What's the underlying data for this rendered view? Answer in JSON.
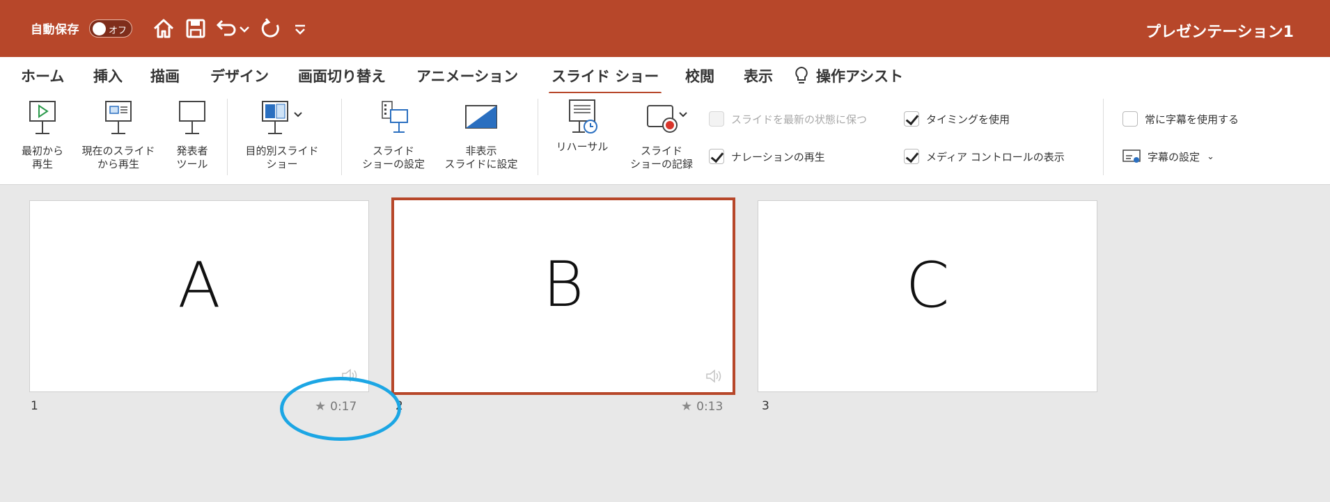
{
  "titlebar": {
    "autosave_label": "自動保存",
    "toggle_text": "オフ",
    "document_title": "プレゼンテーション1",
    "background": "#b7472a"
  },
  "tabs": [
    {
      "label": "ホーム"
    },
    {
      "label": "挿入"
    },
    {
      "label": "描画"
    },
    {
      "label": "デザイン"
    },
    {
      "label": "画面切り替え"
    },
    {
      "label": "アニメーション"
    },
    {
      "label": "スライド ショー",
      "active": true
    },
    {
      "label": "校閲"
    },
    {
      "label": "表示"
    },
    {
      "label": "操作アシスト"
    }
  ],
  "ribbon": {
    "from_start": "最初から\n再生",
    "from_current": "現在のスライド\nから再生",
    "presenter_tools": "発表者\nツール",
    "custom_show": "目的別スライド\nショー",
    "setup_show": "スライド\nショーの設定",
    "hide_slide": "非表示\nスライドに設定",
    "rehearse": "リハーサル",
    "record_show": "スライド\nショーの記録",
    "keep_updated": "スライドを最新の状態に保つ",
    "play_narrations": "ナレーションの再生",
    "use_timings": "タイミングを使用",
    "show_media_controls": "メディア コントロールの表示",
    "always_subtitles": "常に字幕を使用する",
    "subtitle_settings": "字幕の設定"
  },
  "checkbox_states": {
    "keep_updated": false,
    "play_narrations": true,
    "use_timings": true,
    "show_media_controls": true,
    "always_subtitles": false
  },
  "slides": [
    {
      "letter": "A",
      "number": "1",
      "timing": "0:17",
      "selected": false
    },
    {
      "letter": "B",
      "number": "2",
      "timing": "0:13",
      "selected": true
    },
    {
      "letter": "C",
      "number": "3",
      "timing": "",
      "selected": false
    }
  ],
  "colors": {
    "accent": "#b7472a",
    "highlight": "#1ca6e4",
    "sorter_background": "#e8e8e8"
  }
}
